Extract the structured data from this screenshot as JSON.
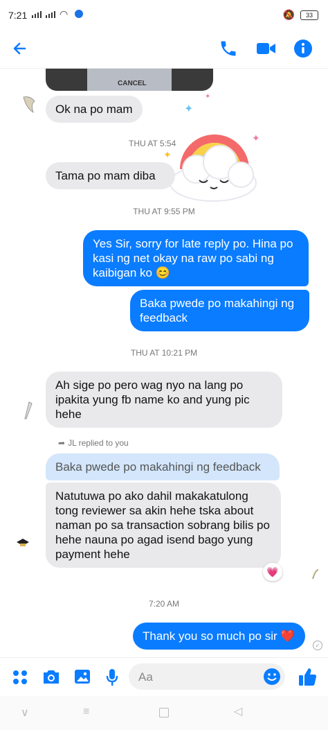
{
  "status": {
    "time": "7:21",
    "battery": "33"
  },
  "header": {
    "back_icon": "back-arrow-icon",
    "call_icon": "phone-icon",
    "video_icon": "video-icon",
    "info_icon": "info-icon"
  },
  "image_snippet": {
    "text": "CANCEL"
  },
  "messages": [
    {
      "text": "Ok na po mam"
    },
    {
      "text": "Tama po mam diba"
    },
    {
      "text": "Yes Sir, sorry for late reply po. Hina po kasi ng net okay na raw po sabi ng kaibigan ko 😊"
    },
    {
      "text": "Baka pwede po makahingi ng feedback"
    },
    {
      "text": "Ah sige po pero wag nyo na lang po ipakita yung fb name ko and yung pic hehe"
    },
    {
      "text": "Natutuwa po ako dahil makakatulong tong reviewer sa akin hehe tska about naman po sa transaction sobrang bilis po hehe nauna po agad isend bago yung payment hehe"
    },
    {
      "text": "Thank you so much po sir ❤️"
    }
  ],
  "timestamps": [
    "THU AT 5:54",
    "THU AT 9:55 PM",
    "THU AT 10:21 PM",
    "7:20 AM"
  ],
  "reply": {
    "label": "JL replied to you",
    "quoted": "Baka pwede po makahingi ng feedback"
  },
  "reaction": "💗",
  "composer": {
    "placeholder": "Aa"
  },
  "colors": {
    "accent": "#0a7cff",
    "incoming": "#e9e9eb",
    "quoted": "#d3e6fb"
  }
}
